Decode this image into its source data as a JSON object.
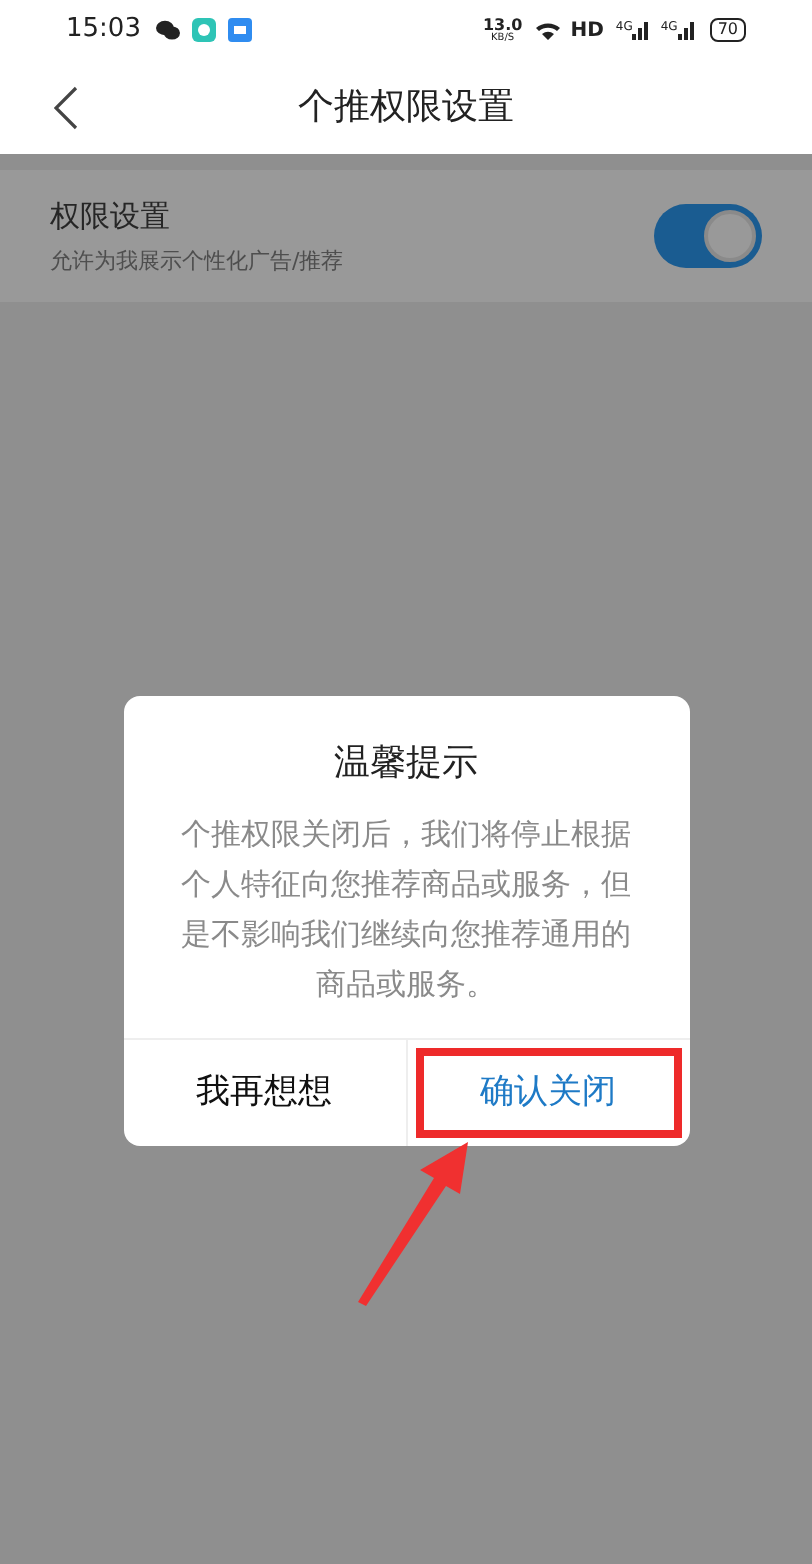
{
  "status_bar": {
    "time": "15:03",
    "speed": "13.0",
    "speed_unit": "KB/S",
    "hd": "HD",
    "networks": [
      "4G",
      "4G"
    ],
    "battery": "70"
  },
  "header": {
    "title": "个推权限设置"
  },
  "setting": {
    "title": "权限设置",
    "subtitle": "允许为我展示个性化广告/推荐",
    "on": true
  },
  "dialog": {
    "title": "温馨提示",
    "message": "个推权限关闭后，我们将停止根据个人特征向您推荐商品或服务，但是不影响我们继续向您推荐通用的商品或服务。",
    "buttons": [
      {
        "label": "我再想想",
        "kind": "cancel",
        "annotated": false
      },
      {
        "label": "确认关闭",
        "kind": "confirm",
        "annotated": true
      }
    ]
  }
}
